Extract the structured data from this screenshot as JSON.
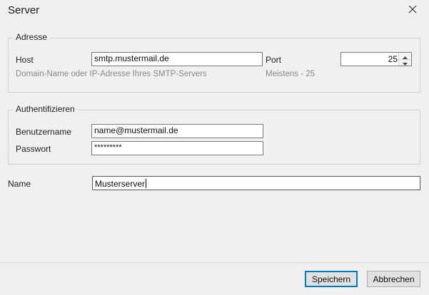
{
  "window": {
    "title": "Server",
    "close_icon": "close-icon"
  },
  "adresse": {
    "legend": "Adresse",
    "host_label": "Host",
    "host_value": "smtp.mustermail.de",
    "host_hint": "Domain-Name oder IP-Adresse Ihres SMTP-Servers",
    "port_label": "Port",
    "port_value": "25",
    "port_hint": "Meistens - 25"
  },
  "auth": {
    "legend": "Authentifizieren",
    "user_label": "Benutzername",
    "user_value": "name@mustermail.de",
    "pass_label": "Passwort",
    "pass_value": "*********"
  },
  "name": {
    "label": "Name",
    "value": "Musterserver"
  },
  "buttons": {
    "save": "Speichern",
    "cancel": "Abbrechen"
  }
}
